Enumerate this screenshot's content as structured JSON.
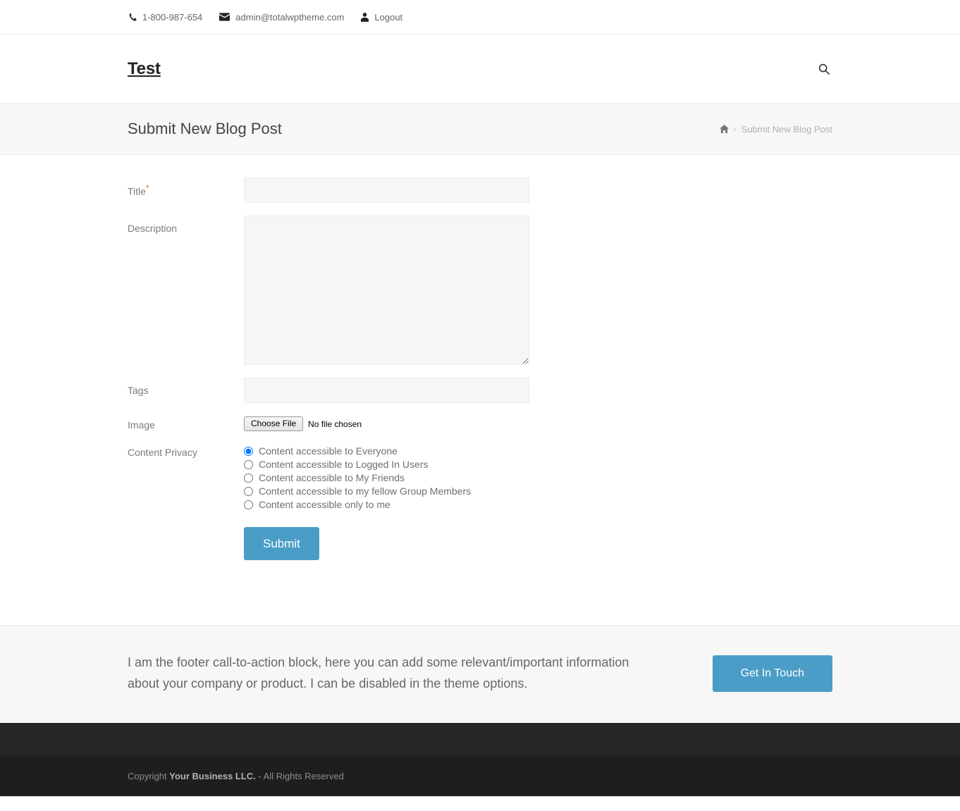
{
  "topbar": {
    "phone": "1-800-987-654",
    "email": "admin@totalwptheme.com",
    "logout": "Logout",
    "icons": {
      "phone": "phone-icon",
      "email": "envelope-icon",
      "user": "user-icon"
    }
  },
  "header": {
    "site_title": "Test",
    "search_icon": "search-icon"
  },
  "page_header": {
    "title": "Submit New Blog Post",
    "breadcrumb": {
      "home_icon": "home-icon",
      "separator": "›",
      "current": "Submit New Blog Post"
    }
  },
  "form": {
    "title_label": "Title",
    "title_required_mark": "*",
    "title_value": "",
    "title_placeholder": "",
    "description_label": "Description",
    "description_value": "",
    "description_placeholder": "",
    "tags_label": "Tags",
    "tags_value": "",
    "tags_placeholder": "",
    "image_label": "Image",
    "choose_file_button": "Choose File",
    "file_status": "No file chosen",
    "privacy_label": "Content Privacy",
    "privacy_options": [
      {
        "label": "Content accessible to Everyone",
        "selected": true
      },
      {
        "label": "Content accessible to Logged In Users",
        "selected": false
      },
      {
        "label": "Content accessible to My Friends",
        "selected": false
      },
      {
        "label": "Content accessible to my fellow Group Members",
        "selected": false
      },
      {
        "label": "Content accessible only to me",
        "selected": false
      }
    ],
    "submit_label": "Submit"
  },
  "cta": {
    "text": "I am the footer call-to-action block, here you can add some relevant/important information about your company or product. I can be disabled in the theme options.",
    "button_label": "Get In Touch"
  },
  "footer": {
    "copyright_prefix": "Copyright ",
    "copyright_business": "Your Business LLC.",
    "copyright_suffix": " - All Rights Reserved"
  },
  "colors": {
    "accent": "#4a9dc6",
    "page_header_bg": "#f7f7f7",
    "input_bg": "#f6f6f6",
    "footer_dark": "#1e1e1e",
    "footer_widgets": "#262626",
    "required_mark": "#c87a3a"
  }
}
